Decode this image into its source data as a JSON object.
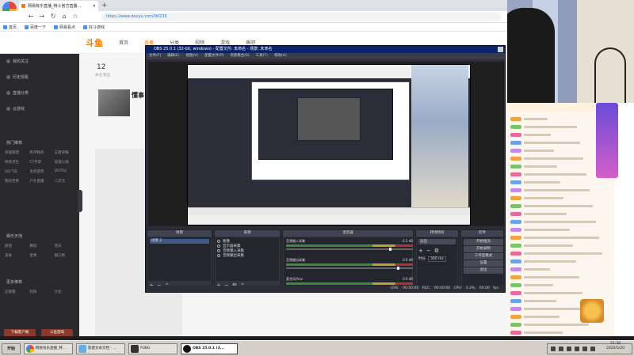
{
  "browser": {
    "logo_label": "浏览器",
    "tab_title": "网易有乐直播_特斗官方直播...",
    "new_tab": "+",
    "url": "https://www.douyu.com/90235",
    "nav": {
      "back": "←",
      "forward": "→",
      "reload": "↻",
      "home": "⌂",
      "star": "☆"
    },
    "bookmarks": [
      "首页",
      "百度一下",
      "网易看点",
      "好斗游戏"
    ]
  },
  "site": {
    "logo": "斗鱼",
    "nav": [
      "首页",
      "直播",
      "分类",
      "视频",
      "游戏",
      "鱼吧"
    ],
    "stat": "12",
    "stat_sub": "关注 粉丝",
    "content_title": "懂事",
    "sidebar": {
      "items": [
        "我的关注",
        "历史观看",
        "直播分类",
        "云游戏"
      ],
      "section1": "热门推荐",
      "grid1": [
        "英雄联盟",
        "和平精英",
        "王者荣耀",
        "绝地求生",
        "CF手游",
        "穿越火线",
        "QQ飞车",
        "主机游戏",
        "DOTA2",
        "我的世界",
        "户外直播",
        "二次元"
      ],
      "section2": "娱乐天地",
      "grid2": [
        "颜值",
        "舞蹈",
        "音乐",
        "美食",
        "星秀",
        "脱口秀"
      ],
      "section3": "更多推荐",
      "grid3": [
        "正能量",
        "科技",
        "文化"
      ],
      "btn_left": "下载客户端",
      "btn_right": "斗鱼游戏"
    }
  },
  "obs": {
    "title": "OBS 25.0.1 (32-bit, windows) - 配置文件: 未命名 - 场景: 未命名",
    "menu": [
      "文件(F)",
      "编辑(E)",
      "视图(V)",
      "配置文件(P)",
      "场景集合(S)",
      "工具(T)",
      "帮助(H)"
    ],
    "docks": {
      "scenes": {
        "title": "场景",
        "items": [
          "场景 2"
        ]
      },
      "sources": {
        "title": "来源",
        "items": [
          "图像",
          "显示器采集",
          "音频输入采集",
          "音频输出采集"
        ]
      },
      "mixer": {
        "title": "混音器",
        "channels": [
          "音频输入采集",
          "音频输出采集",
          "麦克风/Aux"
        ],
        "db": [
          "-2.2 dB",
          "0.0 dB",
          "0.0 dB"
        ]
      },
      "transitions": {
        "title": "转场特效",
        "mode": "淡出",
        "duration_label": "时长",
        "duration": "300 ms"
      },
      "controls": {
        "title": "控件",
        "buttons": [
          "开始推流",
          "开始录制",
          "工作室模式",
          "设置",
          "退出"
        ]
      }
    },
    "status": "LIVE: 00:00:00   REC: 00:00:00   CPU: 3.3%, 60.00 fps"
  },
  "chat": {
    "lines": 28
  },
  "taskbar": {
    "start": "开始",
    "tasks": [
      "网易有乐直播_特...",
      "新建文本文档 - ...",
      "PUBG",
      "OBS 25.0.1 (3..."
    ],
    "clock_time": "21:38",
    "clock_date": "2020/5/20"
  },
  "colors": {
    "accent": "#ff7700",
    "obs_bg": "#2b2e38",
    "title_blue": "#0a246a"
  }
}
